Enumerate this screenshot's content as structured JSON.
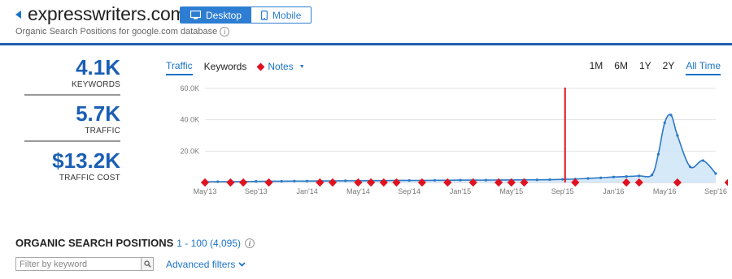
{
  "header": {
    "domain": "expresswriters.com",
    "subtitle": "Organic Search Positions for google.com database",
    "device_tabs": [
      {
        "label": "Desktop",
        "active": true,
        "icon": "desktop-icon"
      },
      {
        "label": "Mobile",
        "active": false,
        "icon": "mobile-icon"
      }
    ]
  },
  "kpis": [
    {
      "value": "4.1K",
      "label": "KEYWORDS"
    },
    {
      "value": "5.7K",
      "label": "TRAFFIC"
    },
    {
      "value": "$13.2K",
      "label": "TRAFFIC COST"
    }
  ],
  "chart_tabs": {
    "traffic": "Traffic",
    "keywords": "Keywords",
    "notes": "Notes"
  },
  "range_tabs": [
    "1M",
    "6M",
    "1Y",
    "2Y",
    "All Time"
  ],
  "range_active": "All Time",
  "chart_data": {
    "type": "area",
    "title": "",
    "xlabel": "",
    "ylabel": "",
    "ylim": [
      0,
      60000
    ],
    "y_ticks": [
      "60.0K",
      "40.0K",
      "20.0K"
    ],
    "y_tick_values": [
      60000,
      40000,
      20000
    ],
    "x_ticks": [
      "May'13",
      "Sep'13",
      "Jan'14",
      "May'14",
      "Sep'14",
      "Jan'15",
      "May'15",
      "Sep'15",
      "Jan'16",
      "May'16",
      "Sep'16"
    ],
    "x_tick_months": [
      0,
      4,
      8,
      12,
      16,
      20,
      24,
      28,
      32,
      36,
      40
    ],
    "grid": true,
    "colors": {
      "line": "#2b78c5",
      "fill": "#cfe5f8",
      "note": "#e0121f",
      "marker_line": "#e0121f"
    },
    "series": [
      {
        "months": [
          0,
          1,
          2,
          3,
          4,
          5,
          6,
          7,
          8,
          9,
          10,
          11,
          12,
          13,
          14,
          15,
          16,
          17,
          18,
          19,
          20,
          21,
          22,
          23,
          24,
          25,
          26,
          27,
          28,
          29,
          30,
          31,
          32,
          33,
          34,
          35,
          35.5,
          36,
          36.5,
          37,
          38,
          39,
          40
        ],
        "values": [
          400,
          500,
          500,
          600,
          700,
          800,
          800,
          900,
          900,
          1000,
          1000,
          1100,
          1100,
          1200,
          1200,
          1300,
          1300,
          1300,
          1400,
          1400,
          1500,
          1500,
          1500,
          1600,
          1600,
          1700,
          1700,
          1800,
          2000,
          2200,
          2600,
          3000,
          3500,
          3800,
          4200,
          4800,
          18000,
          38000,
          43000,
          30000,
          10000,
          14000,
          5700
        ]
      }
    ],
    "notes_months": [
      0,
      2,
      3,
      5,
      9,
      10,
      12,
      13,
      14,
      15,
      17,
      19,
      21,
      23,
      24,
      25,
      29,
      33,
      34,
      37,
      41
    ],
    "marker_month": 28.2
  },
  "organic": {
    "title": "ORGANIC SEARCH POSITIONS",
    "range": "1 - 100 (4,095)",
    "filter_placeholder": "Filter by keyword",
    "advanced_filters": "Advanced filters"
  }
}
